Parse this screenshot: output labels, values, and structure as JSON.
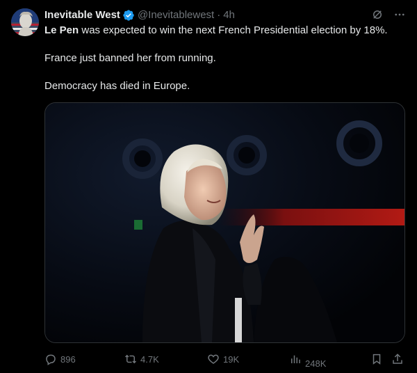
{
  "tweet": {
    "display_name": "Inevitable West",
    "handle": "@Inevitablewest",
    "separator": "·",
    "time": "4h",
    "text_bold": "Le Pen",
    "text_line1_rest": " was expected to win the next French Presidential election by 18%.",
    "text_line2": "France just banned her from running.",
    "text_line3": "Democracy has died in Europe."
  },
  "actions": {
    "replies": "896",
    "reposts": "4.7K",
    "likes": "19K",
    "views": "248K"
  },
  "icons": {
    "verified": "verified-badge-icon",
    "grok": "grok-icon",
    "more": "more-icon",
    "reply": "reply-icon",
    "repost": "repost-icon",
    "like": "heart-icon",
    "views": "views-icon",
    "bookmark": "bookmark-icon",
    "share": "share-icon"
  },
  "colors": {
    "background": "#000000",
    "text": "#e7e9ea",
    "muted": "#71767b",
    "verified": "#1d9bf0",
    "border": "#2f3336"
  }
}
